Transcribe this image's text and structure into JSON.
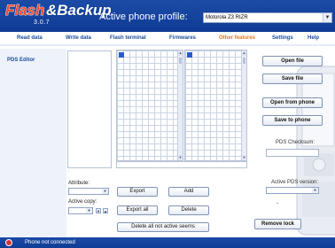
{
  "app": {
    "logo_text": "Flash & Backup",
    "version": "3.0.7"
  },
  "profile": {
    "label": "Active phone profile:",
    "selected": "Motorola Z3 RIZR"
  },
  "nav": {
    "items": [
      {
        "label": "Read data"
      },
      {
        "label": "Write data"
      },
      {
        "label": "Flash terminal"
      },
      {
        "label": "Firmwares"
      },
      {
        "label": "Other features"
      },
      {
        "label": "Settings"
      },
      {
        "label": "Help"
      }
    ],
    "active": "Other features"
  },
  "sidebar": {
    "items": [
      {
        "label": "PDS Editor"
      }
    ]
  },
  "editor": {
    "attribute_label": "Attribute:",
    "active_copy_label": "Active copy:",
    "buttons": {
      "export": "Export",
      "add": "Add",
      "export_all": "Export all",
      "delete": "Delete",
      "delete_all": "Delete all not active seems"
    }
  },
  "right": {
    "open_file": "Open file",
    "save_file": "Save file",
    "open_from_phone": "Open from phone",
    "save_to_phone": "Save to phone",
    "checksum_label": "PDS Checksum:",
    "pds_version_label": "Active PDS version:",
    "remove_lock": "Remove lock",
    "dash": "-"
  },
  "status": {
    "text": "Phone not connected",
    "indicator_color": "#dd3333"
  },
  "colors": {
    "header": "#1b4ba6",
    "nav_text": "#1a4b9c",
    "nav_active": "#e07b20"
  }
}
